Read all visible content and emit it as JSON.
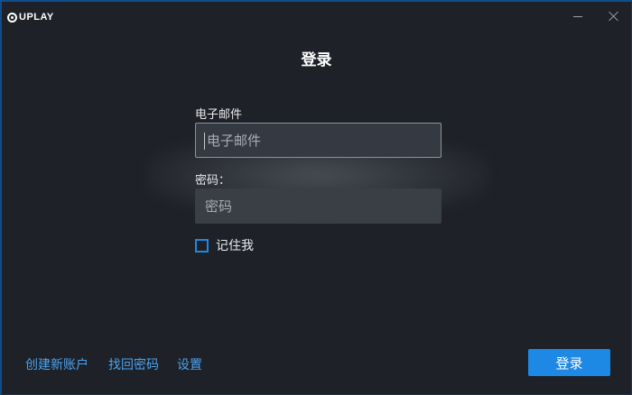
{
  "app": {
    "logo_text": "UPLAY"
  },
  "window_controls": {
    "minimize_icon": "minimize-icon",
    "close_icon": "close-icon"
  },
  "login": {
    "title": "登录",
    "email_label": "电子邮件",
    "email_placeholder": "电子邮件",
    "email_value": "",
    "password_label": "密码：",
    "password_placeholder": "密码",
    "password_value": "",
    "remember_label": "记住我",
    "remember_checked": false,
    "submit_label": "登录"
  },
  "footer": {
    "create_account": "创建新账户",
    "recover_password": "找回密码",
    "settings": "设置"
  },
  "colors": {
    "background": "#1e2127",
    "accent": "#1e88e5",
    "link": "#4ba3f0",
    "input_bg": "#3a3e45"
  }
}
